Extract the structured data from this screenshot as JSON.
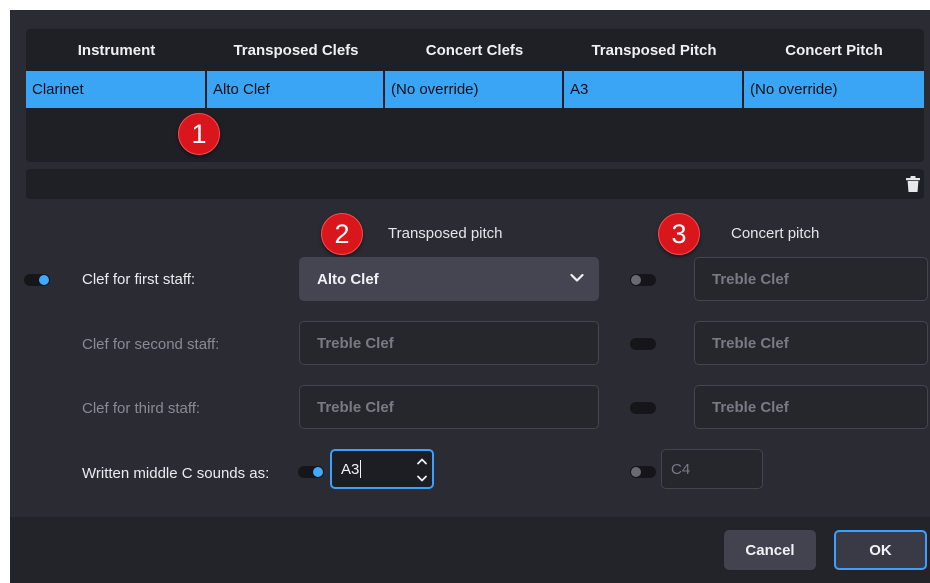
{
  "table": {
    "headers": [
      "Instrument",
      "Transposed Clefs",
      "Concert Clefs",
      "Transposed Pitch",
      "Concert Pitch"
    ],
    "rows": [
      [
        "Clarinet",
        "Alto Clef",
        "(No override)",
        "A3",
        "(No override)"
      ]
    ]
  },
  "callouts": [
    "1",
    "2",
    "3"
  ],
  "columns": {
    "transposed": "Transposed pitch",
    "concert": "Concert pitch"
  },
  "rows": {
    "first_staff": {
      "label": "Clef for first staff:",
      "transposed": "Alto Clef",
      "concert": "Treble Clef"
    },
    "second_staff": {
      "label": "Clef for second staff:",
      "transposed": "Treble Clef",
      "concert": "Treble Clef"
    },
    "third_staff": {
      "label": "Clef for third staff:",
      "transposed": "Treble Clef",
      "concert": "Treble Clef"
    },
    "middle_c": {
      "label": "Written middle C sounds as:",
      "transposed": "A3",
      "concert": "C4"
    }
  },
  "buttons": {
    "cancel": "Cancel",
    "ok": "OK"
  },
  "colors": {
    "accent": "#3ba0ff",
    "selection": "#3aa4f5",
    "callout": "#d8161b",
    "background": "#2b2b33"
  },
  "icons": {
    "delete": "trash-icon",
    "dropdown": "chevron-down-icon",
    "spin_up": "chevron-up-icon",
    "spin_down": "chevron-down-icon"
  }
}
